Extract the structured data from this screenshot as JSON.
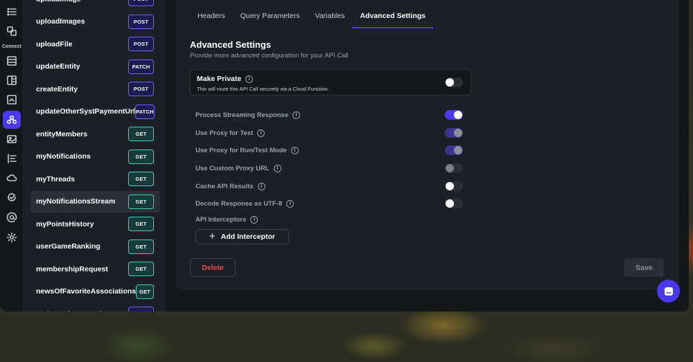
{
  "rail": {
    "section_label": "Connect",
    "icons": [
      "list-icon",
      "layout-icon",
      "table-icon",
      "split-view-icon",
      "media-icon",
      "api-icon",
      "image-icon",
      "list-align-icon",
      "cloud-icon",
      "check-add-icon",
      "at-icon",
      "gear-icon"
    ]
  },
  "api_list": [
    {
      "name": "uploadImage",
      "method": "POST"
    },
    {
      "name": "uploadImages",
      "method": "POST"
    },
    {
      "name": "uploadFile",
      "method": "POST"
    },
    {
      "name": "updateEntity",
      "method": "PATCH"
    },
    {
      "name": "createEntity",
      "method": "POST"
    },
    {
      "name": "updateOtherSystPaymentUrl",
      "method": "PATCH"
    },
    {
      "name": "entityMembers",
      "method": "GET"
    },
    {
      "name": "myNotifications",
      "method": "GET"
    },
    {
      "name": "myThreads",
      "method": "GET"
    },
    {
      "name": "myNotificationsStream",
      "method": "GET",
      "selected": true
    },
    {
      "name": "myPointsHistory",
      "method": "GET"
    },
    {
      "name": "userGameRanking",
      "method": "GET"
    },
    {
      "name": "membershipRequest",
      "method": "GET"
    },
    {
      "name": "newsOfFavoriteAssociations",
      "method": "GET"
    },
    {
      "name": "entityUpdateFavorite",
      "method": "POST"
    }
  ],
  "tabs": [
    {
      "label": "Headers"
    },
    {
      "label": "Query Parameters"
    },
    {
      "label": "Variables"
    },
    {
      "label": "Advanced Settings",
      "active": true
    }
  ],
  "advanced": {
    "title": "Advanced Settings",
    "subtitle": "Provide more advanced configuration for your API Call",
    "make_private": {
      "label": "Make Private",
      "description": "This will route this API Call securely via a Cloud Function.",
      "enabled": false
    },
    "settings": [
      {
        "label": "Process Streaming Response",
        "state": "on"
      },
      {
        "label": "Use Proxy for Test",
        "state": "on-dim"
      },
      {
        "label": "Use Proxy for Run/Test Mode",
        "state": "on-dim"
      },
      {
        "label": "Use Custom Proxy URL",
        "state": "off-dim"
      },
      {
        "label": "Cache API Results",
        "state": "off"
      },
      {
        "label": "Decode Response as UTF-8",
        "state": "off"
      }
    ],
    "interceptors_label": "API Interceptors",
    "add_interceptor_label": "Add Interceptor",
    "delete_label": "Delete",
    "save_label": "Save"
  },
  "colors": {
    "accent": "#4b39ef",
    "get_badge": "#39d2c0",
    "post_badge": "#6c63ff",
    "danger": "#e24c4b"
  }
}
